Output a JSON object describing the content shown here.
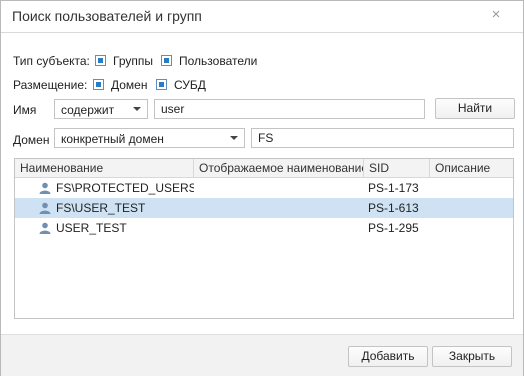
{
  "dialog": {
    "title": "Поиск пользователей и групп",
    "close_glyph": "×"
  },
  "filters": {
    "subject_type": {
      "label": "Тип субъекта:",
      "options": [
        {
          "label": "Группы",
          "checked": true
        },
        {
          "label": "Пользователи",
          "checked": true
        }
      ]
    },
    "placement": {
      "label": "Размещение:",
      "options": [
        {
          "label": "Домен",
          "checked": true
        },
        {
          "label": "СУБД",
          "checked": true
        }
      ]
    },
    "name": {
      "label": "Имя",
      "condition": "содержит",
      "value": "user",
      "find_button": "Найти"
    },
    "domain": {
      "label": "Домен",
      "mode": "конкретный домен",
      "value": "FS"
    }
  },
  "table": {
    "columns": [
      "Наименование",
      "Отображаемое наименование",
      "SID",
      "Описание"
    ],
    "rows": [
      {
        "name": "FS\\PROTECTED_USERS",
        "display_name": "",
        "sid": "PS-1-173",
        "description": "",
        "icon": "user-icon",
        "selected": false
      },
      {
        "name": "FS\\USER_TEST",
        "display_name": "",
        "sid": "PS-1-613",
        "description": "",
        "icon": "user-icon",
        "selected": true
      },
      {
        "name": "USER_TEST",
        "display_name": "",
        "sid": "PS-1-295",
        "description": "",
        "icon": "user-icon",
        "selected": false
      }
    ]
  },
  "footer": {
    "add_button": "Добавить",
    "close_button": "Закрыть"
  },
  "colors": {
    "selection": "#cfe2f3",
    "checkbox_accent": "#2b7bc4",
    "user_icon": "#6f8fb3"
  }
}
